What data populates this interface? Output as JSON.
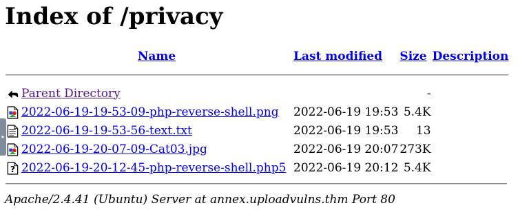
{
  "page": {
    "heading": "Index of /privacy"
  },
  "columns": {
    "name": "Name",
    "last_modified": "Last modified",
    "size": "Size",
    "description": "Description"
  },
  "parent": {
    "label": "Parent Directory",
    "size": "-",
    "icon": "back-arrow-icon"
  },
  "rows": [
    {
      "name": "2022-06-19-19-53-09-php-reverse-shell.png",
      "modified": "2022-06-19 19:53",
      "size": "5.4K",
      "icon": "image-file-icon"
    },
    {
      "name": "2022-06-19-19-53-56-text.txt",
      "modified": "2022-06-19 19:53",
      "size": "13",
      "icon": "text-file-icon"
    },
    {
      "name": "2022-06-19-20-07-09-Cat03.jpg",
      "modified": "2022-06-19 20:07",
      "size": "273K",
      "icon": "image-file-icon"
    },
    {
      "name": "2022-06-19-20-12-45-php-reverse-shell.php5",
      "modified": "2022-06-19 20:12",
      "size": "5.4K",
      "icon": "unknown-file-icon"
    }
  ],
  "footer": {
    "server": "Apache/2.4.41 (Ubuntu) Server at annex.uploadvulns.thm Port 80"
  },
  "colors": {
    "link": "#0000ee",
    "visited_link": "#551a8b",
    "side_tab": "#7f8c9b"
  }
}
